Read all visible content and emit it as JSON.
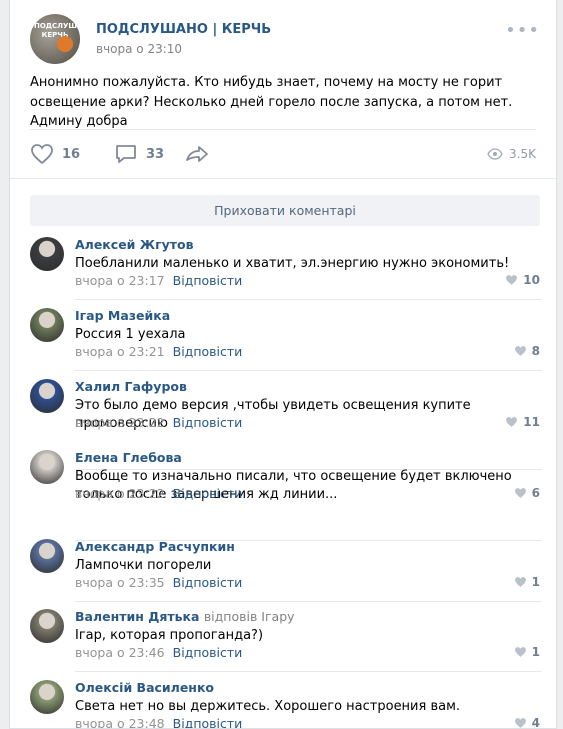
{
  "post": {
    "group_name": "ПОДСЛУШАНО | КЕРЧЬ",
    "time": "вчора о 23:10",
    "avatar_text": "ПОДСЛУШАНО КЕРЧЬ",
    "text": "Анонимно пожалуйста. Кто нибудь знает, почему на мосту не горит освещение арки? Несколько дней горело после запуска, а потом нет. Админу добра",
    "likes": "16",
    "comments": "33",
    "views": "3.5K"
  },
  "hide_comments_label": "Приховати коментарі",
  "reply_label": "Відповісти",
  "comments": [
    {
      "author": "Алексей Жгутов",
      "reply_to": "",
      "text": "Поебланили маленько и хватит, эл.энергию нужно экономить!",
      "time": "вчора о 23:17",
      "likes": "10",
      "avatar_color": "#3b3d3f"
    },
    {
      "author": "Ігар Мазейка",
      "reply_to": "",
      "text": "Россия 1 уехала",
      "time": "вчора о 23:21",
      "likes": "8",
      "avatar_color": "#6e7a5a"
    },
    {
      "author": "Халил Гафуров",
      "reply_to": "",
      "text": "Это было демо версия ,чтобы увидеть освещения купите промоверсию",
      "time": "вчора о 23:22",
      "likes": "11",
      "avatar_color": "#2f4f8f"
    },
    {
      "author": "Елена Глебова",
      "reply_to": "",
      "text": "Вообще то изначально писали, что освещение будет включено только после завершения жд линии...",
      "time": "вчора о 23:22",
      "likes": "6",
      "avatar_color": "#c9c4c0"
    },
    {
      "author": "Александр Расчупкин",
      "reply_to": "",
      "text": "Лампочки погорели",
      "time": "вчора о 23:35",
      "likes": "1",
      "avatar_color": "#5a6f9a"
    },
    {
      "author": "Валентин Дятька",
      "reply_to": "відповів Ігару",
      "text": "Ігар, которая пропоганда?)",
      "time": "вчора о 23:46",
      "likes": "1",
      "avatar_color": "#7d7a6c"
    },
    {
      "author": "Олексій Василенко",
      "reply_to": "",
      "text": "Света нет но вы держитесь. Хорошего настроения вам.",
      "time": "вчора о 23:48",
      "likes": "4",
      "avatar_color": "#8a9a72"
    }
  ],
  "colors": {
    "link": "#2a5885",
    "meta": "#939393",
    "background": "#edeef0"
  },
  "icons": {
    "like": "heart-icon",
    "comment": "comment-icon",
    "share": "share-arrow-icon",
    "views": "eye-icon",
    "more": "more-dots-icon"
  }
}
